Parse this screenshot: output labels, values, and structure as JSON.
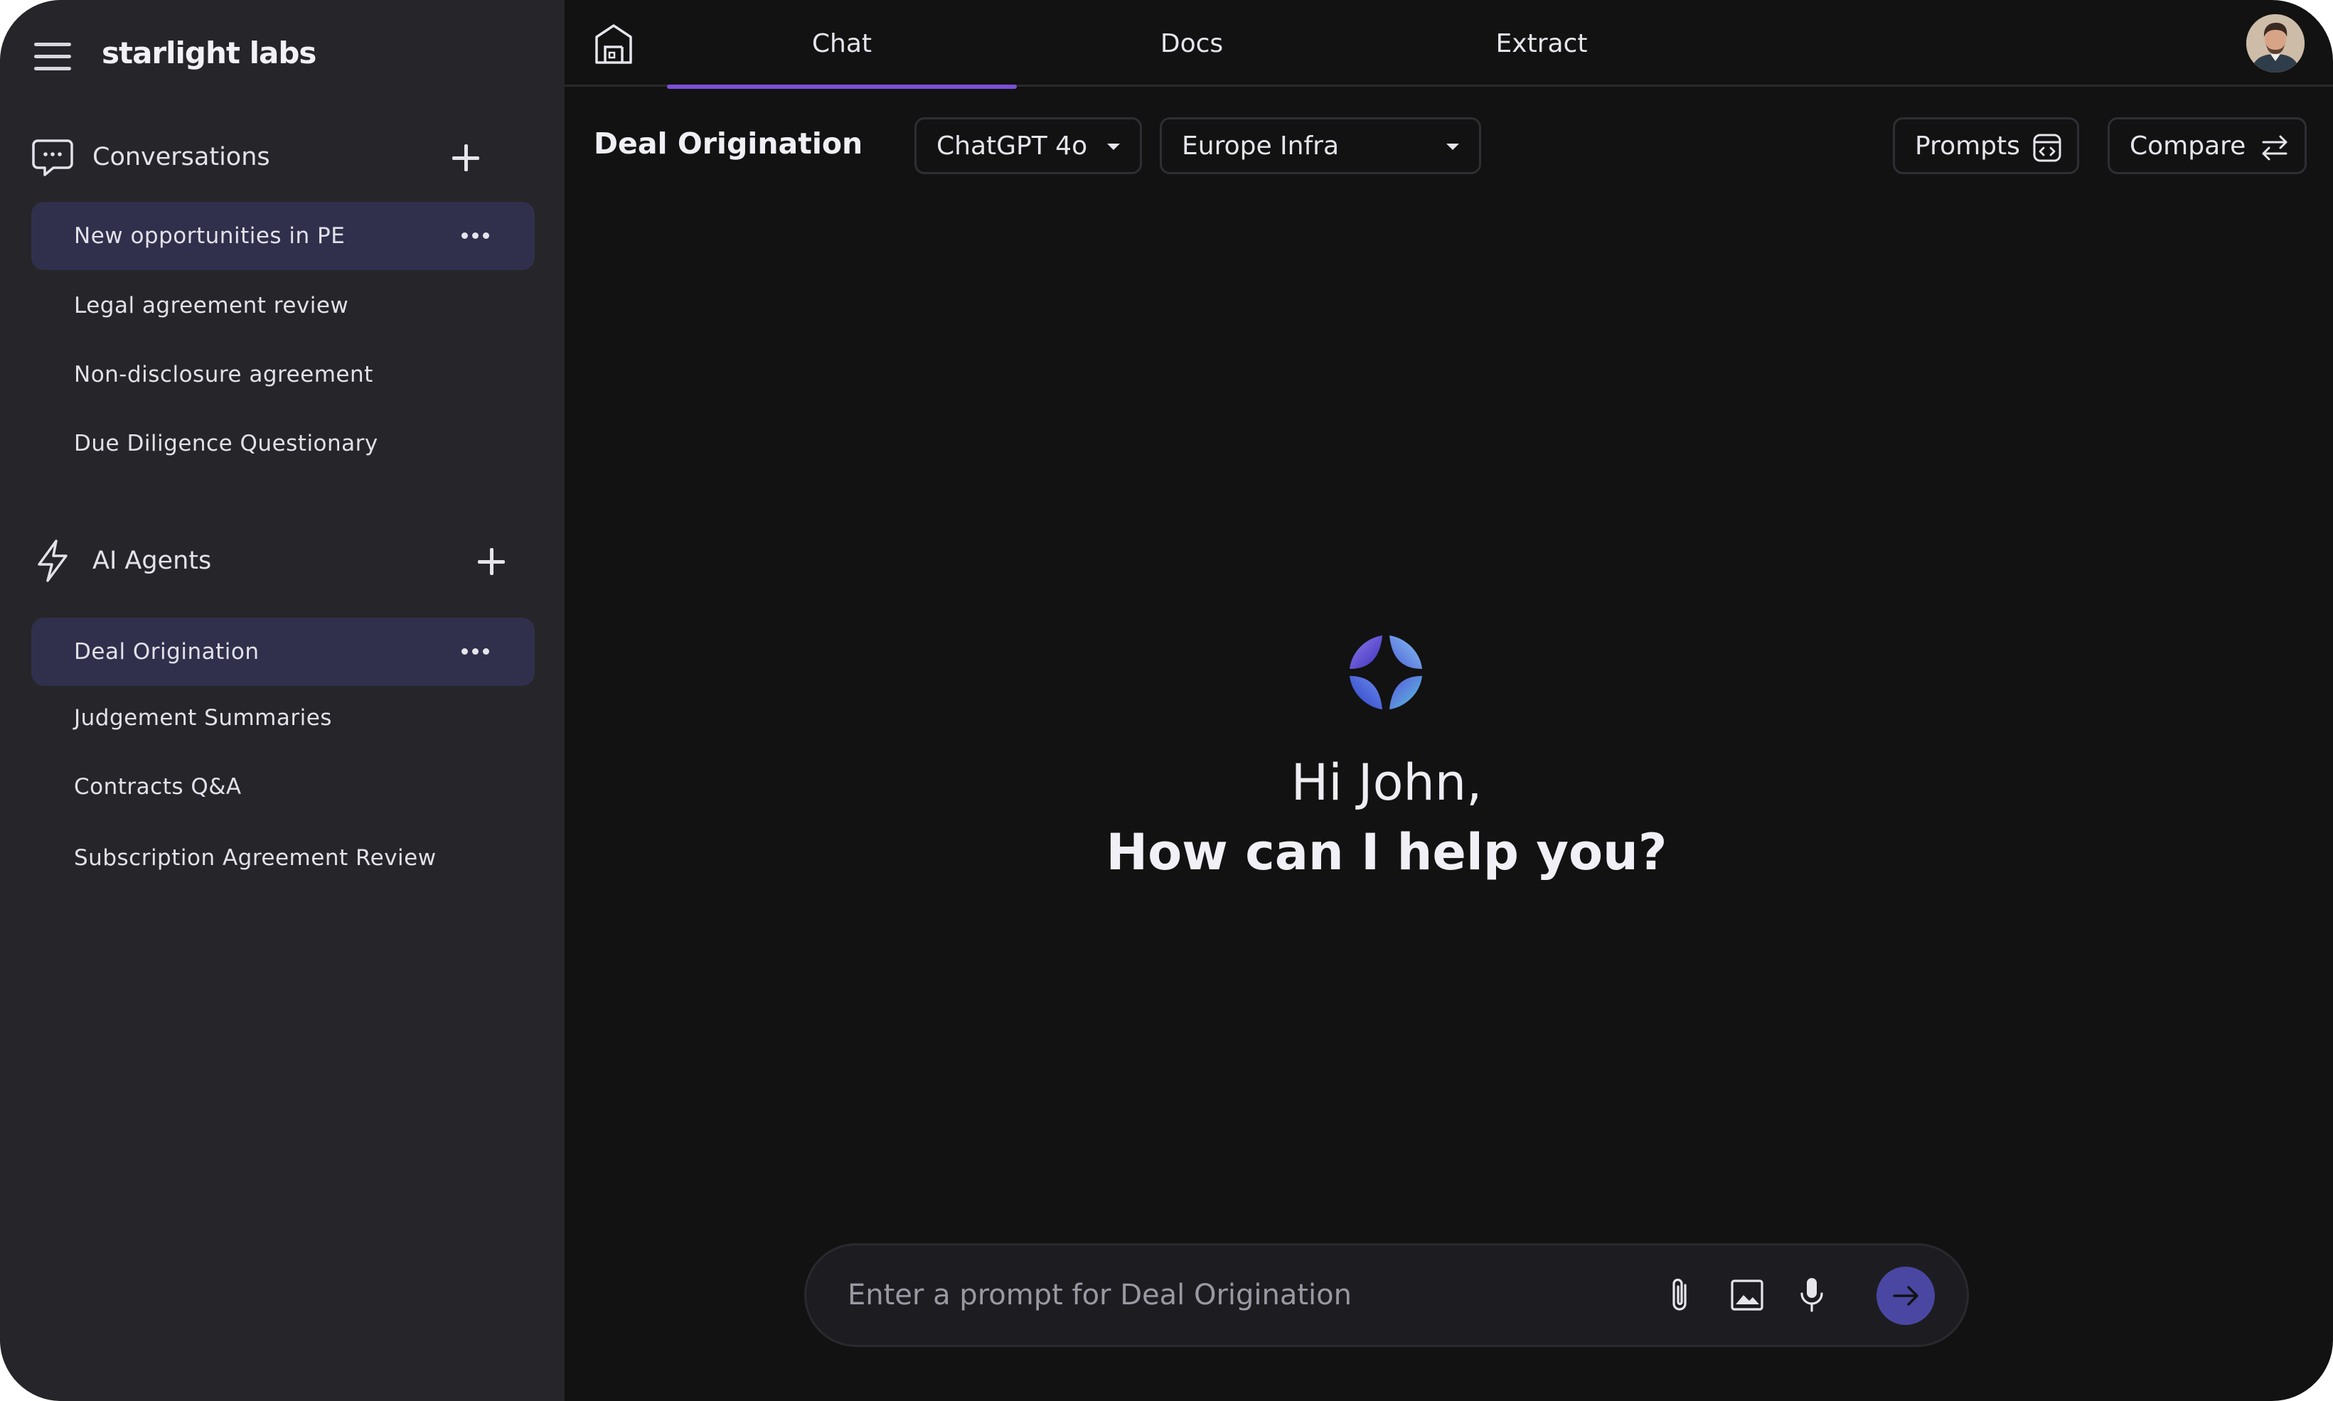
{
  "app": {
    "logo_text": "starlight labs"
  },
  "sidebar": {
    "conversations": {
      "title": "Conversations",
      "items": [
        {
          "label": "New opportunities in PE",
          "active": true
        },
        {
          "label": "Legal agreement review"
        },
        {
          "label": "Non-disclosure agreement"
        },
        {
          "label": "Due Diligence Questionary"
        }
      ]
    },
    "agents": {
      "title": "AI Agents",
      "items": [
        {
          "label": "Deal Origination",
          "active": true
        },
        {
          "label": "Judgement Summaries"
        },
        {
          "label": "Contracts Q&A"
        },
        {
          "label": "Subscription Agreement Review"
        }
      ]
    }
  },
  "header": {
    "tabs": [
      {
        "label": "Chat",
        "active": true
      },
      {
        "label": "Docs"
      },
      {
        "label": "Extract"
      }
    ]
  },
  "toolbar": {
    "page_title": "Deal Origination",
    "model_select": "ChatGPT 4o",
    "workspace_select": "Europe Infra",
    "prompts_label": "Prompts",
    "compare_label": "Compare"
  },
  "greeting": {
    "line1": "Hi John,",
    "line2": "How can I help you?"
  },
  "prompt": {
    "placeholder": "Enter a prompt for Deal Origination"
  },
  "colors": {
    "background": "#121212",
    "sidebar": "#262529",
    "active_item": "#30304d",
    "accent": "#7b4fd8",
    "send_button": "#4a47a3"
  }
}
